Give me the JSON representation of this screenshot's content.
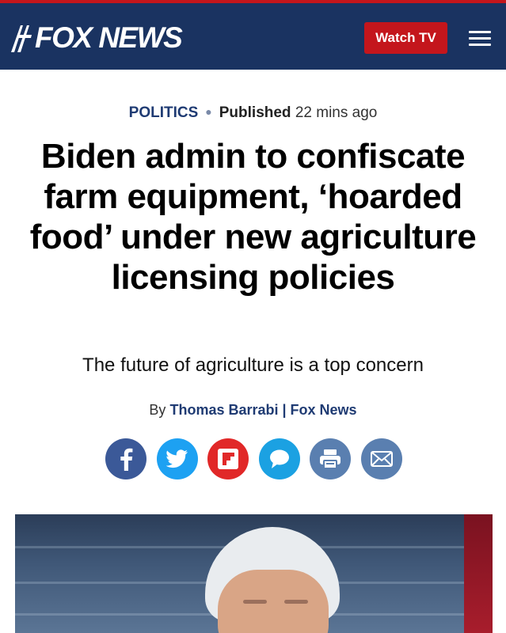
{
  "header": {
    "logo_text": "FOX NEWS",
    "watch_label": "Watch TV",
    "colors": {
      "navy": "#1a3361",
      "red": "#c4161c"
    }
  },
  "article": {
    "category": "POLITICS",
    "published_label": "Published",
    "published_ago": "22 mins ago",
    "headline": "Biden admin to confiscate farm equipment, ‘hoarded food’ under new agriculture licensing policies",
    "subhead": "The future of agriculture is a top concern",
    "by_label": "By",
    "author": "Thomas Barrabi | Fox News"
  },
  "share": [
    {
      "icon": "facebook-icon",
      "color": "#3b5998"
    },
    {
      "icon": "twitter-icon",
      "color": "#1da1f2"
    },
    {
      "icon": "flipboard-icon",
      "color": "#e12828"
    },
    {
      "icon": "comments-icon",
      "color": "#1ba1e2"
    },
    {
      "icon": "print-icon",
      "color": "#5a7fb0"
    },
    {
      "icon": "email-icon",
      "color": "#5a7fb0"
    }
  ]
}
